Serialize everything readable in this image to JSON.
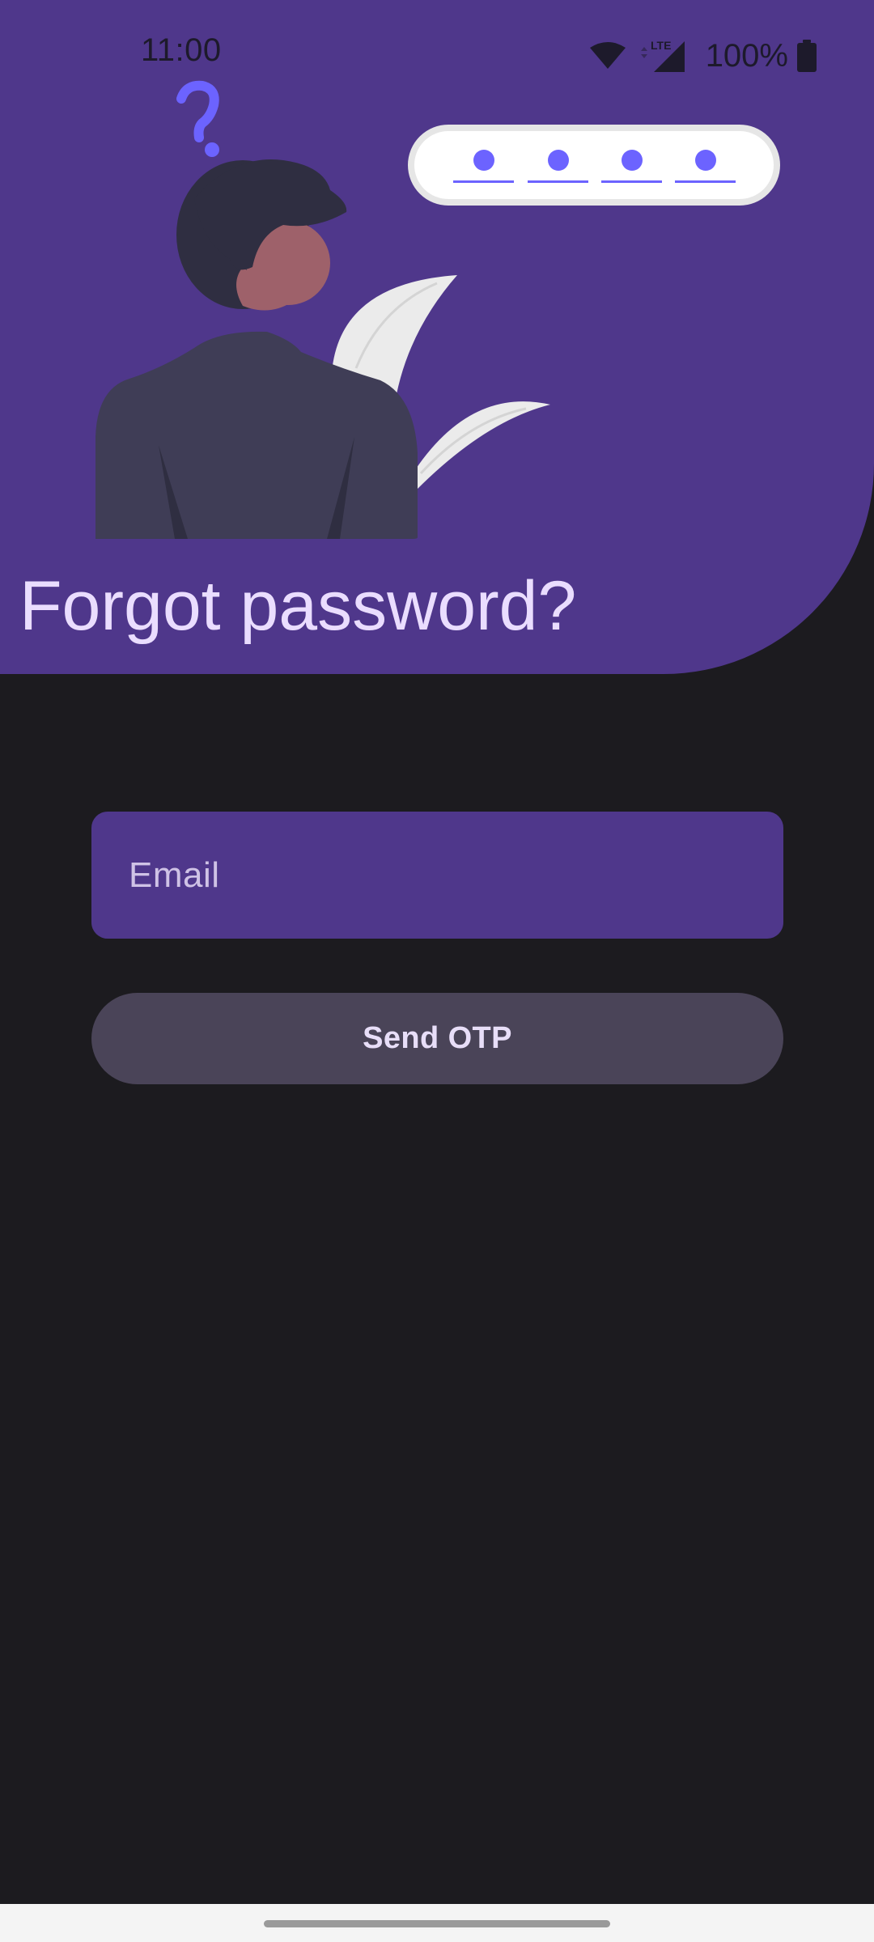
{
  "status_bar": {
    "time": "11:00",
    "battery": "100%",
    "icons": [
      "wifi-icon",
      "lte-signal-icon",
      "battery-icon"
    ]
  },
  "illustration": {
    "icons": [
      "question-mark-icon",
      "person-illustration",
      "leaves-illustration",
      "otp-dots-icon"
    ]
  },
  "page": {
    "title": "Forgot password?"
  },
  "form": {
    "email_placeholder": "Email",
    "email_value": "",
    "send_button_label": "Send OTP"
  },
  "colors": {
    "accent": "#4f378b",
    "background": "#1c1b1f",
    "button": "#4a4458",
    "title_text": "#eaddff",
    "otp_dot": "#6c63ff"
  }
}
